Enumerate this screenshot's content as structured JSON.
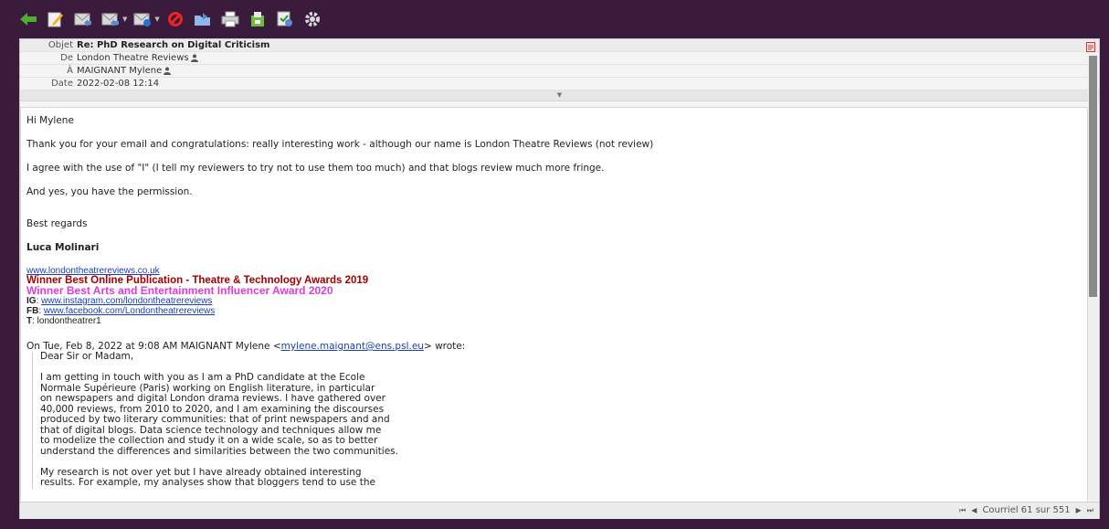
{
  "toolbar": {
    "buttons": [
      {
        "name": "back-icon"
      },
      {
        "name": "compose-icon"
      },
      {
        "name": "reply-icon"
      },
      {
        "name": "reply-all-icon"
      },
      {
        "name": "forward-icon"
      },
      {
        "name": "delete-icon"
      },
      {
        "name": "move-icon"
      },
      {
        "name": "print-icon"
      },
      {
        "name": "download-icon"
      },
      {
        "name": "mark-icon"
      },
      {
        "name": "settings-icon"
      }
    ]
  },
  "headers": {
    "subject_label": "Objet",
    "subject": "Re: PhD Research on Digital Criticism",
    "from_label": "De",
    "from": "London Theatre Reviews",
    "to_label": "À",
    "to": "MAIGNANT Mylene",
    "date_label": "Date",
    "date": "2022-02-08 12:14"
  },
  "body": {
    "greeting": "Hi Mylene",
    "p1": "Thank you for your email and congratulations: really interesting work - although our name is London Theatre Reviews (not review)",
    "p2": "I agree with the use of \"I\" (I tell my reviewers to try not to use them too much) and that blogs review much more fringe.",
    "p3": "And yes, you have the permission.",
    "closing": "Best regards",
    "name": "Luca Molinari",
    "sig_link": "www.londontheatrereviews.co.uk",
    "award1": "Winner Best Online Publication - Theatre & Technology Awards 2019",
    "award2": "Winner Best Arts and Entertainment Influencer Award 2020",
    "ig_label": "IG",
    "ig_link": "www.instagram.com/londontheatrereviews",
    "fb_label": "FB",
    "fb_link": "www.facebook.com/Londontheatrereviews",
    "t_label": "T",
    "t_value": "londontheatrer1",
    "quote_intro_pre": "On Tue, Feb 8, 2022 at 9:08 AM MAIGNANT Mylene <",
    "quote_email": "mylene.maignant@ens.psl.eu",
    "quote_intro_post": "> wrote:",
    "quote_lines": [
      "Dear Sir or Madam,",
      "",
      "I am getting in touch with you as I am a PhD candidate at the Ecole",
      "Normale Supérieure (Paris) working on English literature, in particular",
      "on newspapers and digital London drama reviews. I have gathered over",
      "40,000 reviews, from 2010 to 2020, and I am examining the discourses",
      "produced by two literary communities: that of print newspapers and and",
      "that of digital blogs. Data science technology and techniques allow me",
      "to modelize the collection and study it on a wide scale, so as to better",
      "understand the differences and similarities between the two communities.",
      "",
      "My research is not over yet but I have already obtained interesting",
      "results. For example, my analyses show that bloggers tend to use the"
    ]
  },
  "footer": {
    "pager_text": "Courriel 61 sur 551"
  },
  "colors": {
    "frame": "#3b1b3c",
    "award1": "#a30000",
    "award2": "#e03ad8",
    "link": "#1a3fb8"
  }
}
